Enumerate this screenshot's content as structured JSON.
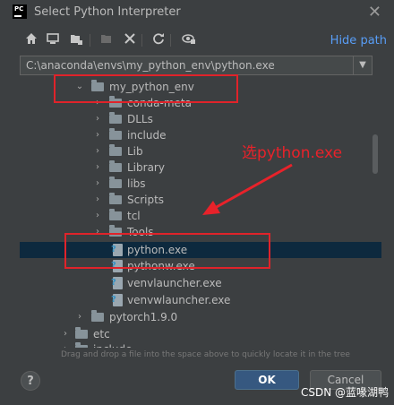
{
  "window": {
    "title": "Select Python Interpreter",
    "close_glyph": "✕"
  },
  "toolbar": {
    "icons": [
      "home-icon",
      "desktop-icon",
      "project-folder-icon",
      "new-folder-icon",
      "delete-icon",
      "refresh-icon",
      "show-hidden-icon"
    ],
    "hide_path": "Hide path"
  },
  "path": {
    "value": "C:\\anaconda\\envs\\my_python_env\\python.exe"
  },
  "tree": {
    "items": [
      {
        "label": "my_python_env"
      },
      {
        "label": "conda-meta"
      },
      {
        "label": "DLLs"
      },
      {
        "label": "include"
      },
      {
        "label": "Lib"
      },
      {
        "label": "Library"
      },
      {
        "label": "libs"
      },
      {
        "label": "Scripts"
      },
      {
        "label": "tcl"
      },
      {
        "label": "Tools"
      },
      {
        "label": "python.exe"
      },
      {
        "label": "pythonw.exe"
      },
      {
        "label": "venvlauncher.exe"
      },
      {
        "label": "venvwlauncher.exe"
      },
      {
        "label": "pytorch1.9.0"
      },
      {
        "label": "etc"
      },
      {
        "label": "include"
      }
    ]
  },
  "hint": "Drag and drop a file into the space above to quickly locate it in the tree",
  "buttons": {
    "help": "?",
    "ok": "OK",
    "cancel": "Cancel"
  },
  "annotation": {
    "text": "选python.exe",
    "color": "#e8222a"
  },
  "watermark": "CSDN @蓝喙湖鸭",
  "colors": {
    "accent": "#589df6",
    "selection": "#0d293e",
    "ok_button": "#365880"
  }
}
